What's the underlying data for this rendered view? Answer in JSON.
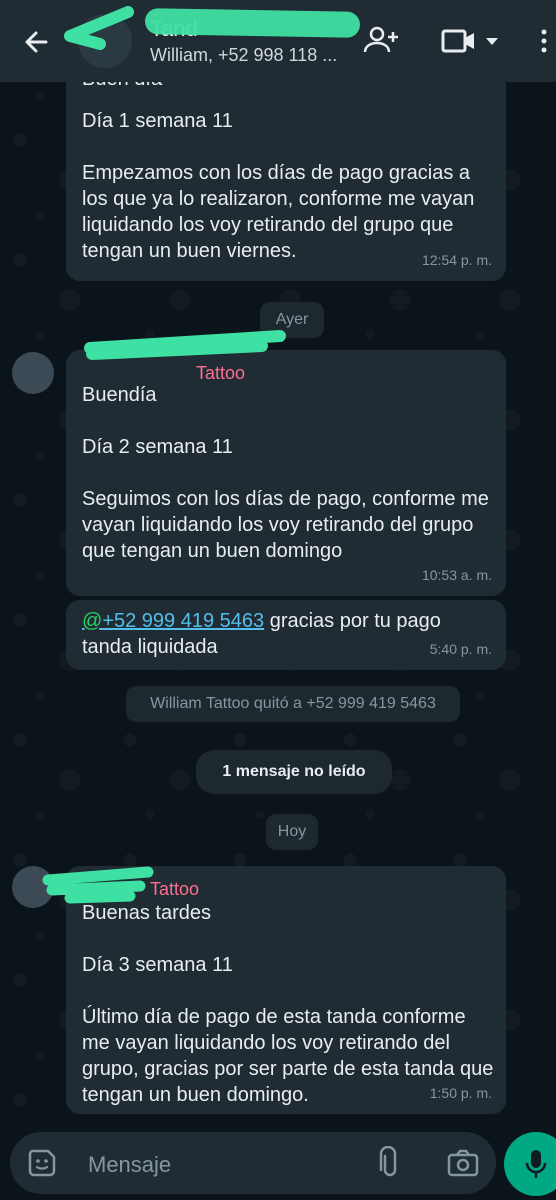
{
  "header": {
    "title": "Tand",
    "subtitle": "William, +52 998 118 ...",
    "icons": [
      "back-arrow-icon",
      "add-person-icon",
      "video-call-icon",
      "dropdown-icon",
      "more-vert-icon"
    ]
  },
  "messages": [
    {
      "partial_text": "Buen día",
      "text": "Día 1 semana 11\n\nEmpezamos con los días de pago gracias a los que ya lo realizaron, conforme me vayan liquidando los voy retirando del grupo que tengan un buen viernes.",
      "time": "12:54 p. m."
    },
    {
      "date_pill": "Ayer"
    },
    {
      "sender": "Tattoo",
      "text": "Buendía\n\nDía 2 semana 11\n\nSeguimos con los días de pago, conforme me vayan liquidando los voy retirando del grupo que tengan un buen domingo",
      "time": "10:53 a. m."
    },
    {
      "mention_at": "@",
      "mention": "+52 999 419 5463",
      "text": " gracias por tu pago tanda liquidada",
      "time": "5:40 p. m."
    },
    {
      "system": "William Tattoo quitó a +52 999 419 5463"
    },
    {
      "unread": "1 mensaje no leído"
    },
    {
      "date_pill": "Hoy"
    },
    {
      "sender": "Tattoo",
      "text": "Buenas tardes\n\nDía 3 semana 11\n\nÚltimo día de pago de esta tanda conforme me vayan liquidando los voy retirando del grupo, gracias por ser parte de esta tanda que tengan un buen domingo.",
      "time": "1:50 p. m."
    }
  ],
  "input": {
    "placeholder": "Mensaje"
  },
  "colors": {
    "header_bg": "#1f2c34",
    "bubble_bg": "#202c33",
    "chat_bg": "#0b141a",
    "accent": "#00a884",
    "sender": "#ff6e91",
    "link": "#53bdeb",
    "redaction": "#3fe0a3"
  }
}
